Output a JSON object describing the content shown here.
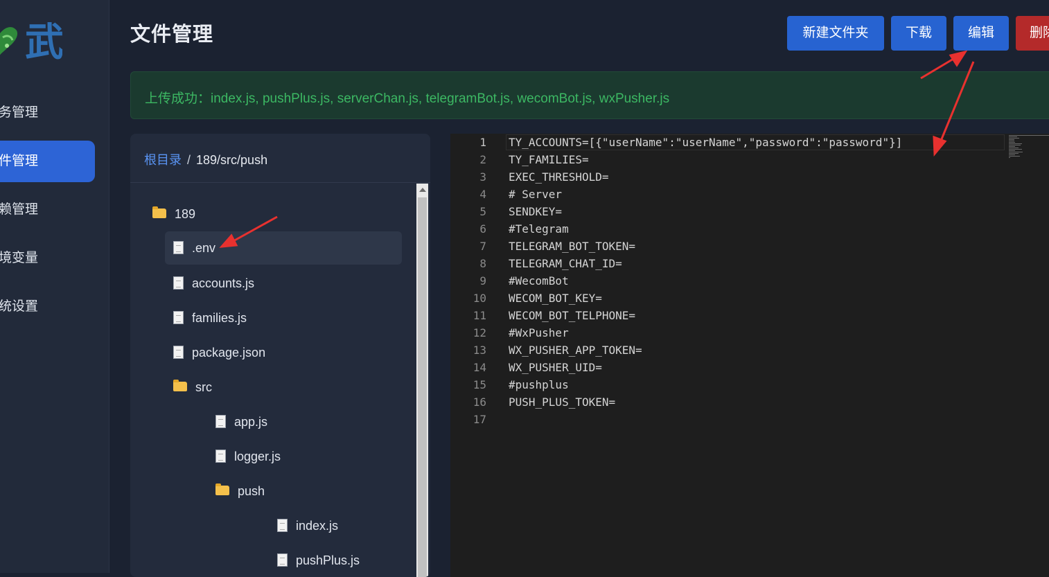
{
  "sidebar": {
    "logo_char": "武",
    "items": [
      {
        "label": "务管理",
        "active": false
      },
      {
        "label": "件管理",
        "active": true
      },
      {
        "label": "赖管理",
        "active": false
      },
      {
        "label": "境变量",
        "active": false
      },
      {
        "label": "统设置",
        "active": false
      }
    ]
  },
  "header": {
    "title": "文件管理",
    "buttons": {
      "new_folder": "新建文件夹",
      "download": "下载",
      "edit": "编辑",
      "delete": "删除"
    }
  },
  "alert": {
    "text": "上传成功：index.js, pushPlus.js, serverChan.js, telegramBot.js, wecomBot.js, wxPusher.js"
  },
  "file_panel": {
    "breadcrumb_root": "根目录",
    "breadcrumb_sep": "/",
    "breadcrumb_path": "189/src/push",
    "tree": [
      {
        "label": "189",
        "type": "folder"
      },
      {
        "label": ".env",
        "type": "file",
        "selected": true
      },
      {
        "label": "accounts.js",
        "type": "file"
      },
      {
        "label": "families.js",
        "type": "file"
      },
      {
        "label": "package.json",
        "type": "file"
      },
      {
        "label": "src",
        "type": "folder"
      },
      {
        "label": "app.js",
        "type": "file"
      },
      {
        "label": "logger.js",
        "type": "file"
      },
      {
        "label": "push",
        "type": "folder"
      },
      {
        "label": "index.js",
        "type": "file"
      },
      {
        "label": "pushPlus.js",
        "type": "file"
      }
    ]
  },
  "editor": {
    "lines": [
      {
        "no": "1",
        "text": "TY_ACCOUNTS=[{\"userName\":\"userName\",\"password\":\"password\"}]"
      },
      {
        "no": "2",
        "text": "TY_FAMILIES="
      },
      {
        "no": "3",
        "text": "EXEC_THRESHOLD="
      },
      {
        "no": "4",
        "text": "# Server"
      },
      {
        "no": "5",
        "text": "SENDKEY="
      },
      {
        "no": "6",
        "text": "#Telegram"
      },
      {
        "no": "7",
        "text": "TELEGRAM_BOT_TOKEN="
      },
      {
        "no": "8",
        "text": "TELEGRAM_CHAT_ID="
      },
      {
        "no": "9",
        "text": "#WecomBot"
      },
      {
        "no": "10",
        "text": "WECOM_BOT_KEY="
      },
      {
        "no": "11",
        "text": "WECOM_BOT_TELPHONE="
      },
      {
        "no": "12",
        "text": "#WxPusher"
      },
      {
        "no": "13",
        "text": "WX_PUSHER_APP_TOKEN="
      },
      {
        "no": "14",
        "text": "WX_PUSHER_UID="
      },
      {
        "no": "15",
        "text": "#pushplus"
      },
      {
        "no": "16",
        "text": "PUSH_PLUS_TOKEN="
      },
      {
        "no": "17",
        "text": ""
      }
    ]
  },
  "colors": {
    "primary": "#2763d1",
    "danger": "#b42a2a",
    "success_text": "#3cb863",
    "annotation": "#e8312f"
  }
}
